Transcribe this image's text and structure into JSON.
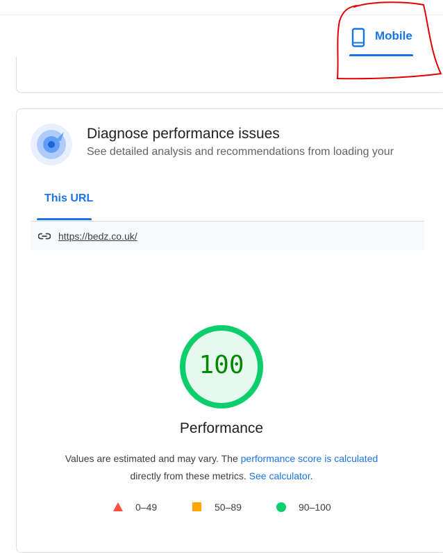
{
  "header": {
    "mobile_tab_label": "Mobile"
  },
  "diagnose": {
    "title": "Diagnose performance issues",
    "subtitle": "See detailed analysis and recommendations from loading your"
  },
  "url_tabs": [
    {
      "label": "This URL",
      "active": true
    }
  ],
  "url_bar": {
    "url": "https://bedz.co.uk/"
  },
  "score": {
    "value": "100",
    "label": "Performance",
    "status_color": "#0cce6b",
    "text_color": "#008800"
  },
  "description": {
    "text1": "Values are estimated and may vary. The ",
    "link1": "performance score is calculated",
    "text2": " directly from these metrics. ",
    "link2": "See calculator",
    "text3": "."
  },
  "legend": [
    {
      "shape": "triangle",
      "range": "0–49",
      "color": "#ff4e42"
    },
    {
      "shape": "square",
      "range": "50–89",
      "color": "#ffa400"
    },
    {
      "shape": "circle",
      "range": "90–100",
      "color": "#0cce6b"
    }
  ],
  "colors": {
    "accent": "#1a73e8",
    "annotation": "#e00000"
  }
}
